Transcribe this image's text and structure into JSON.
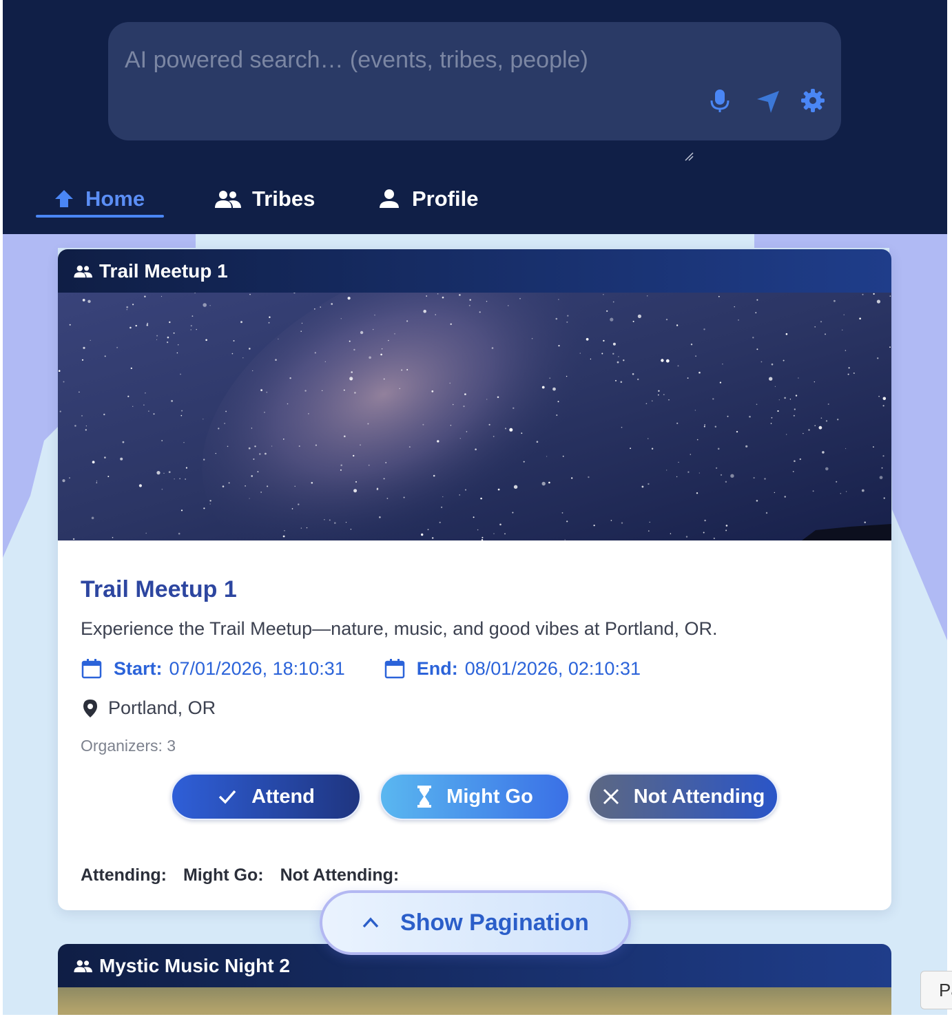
{
  "search": {
    "placeholder": "AI powered search… (events, tribes, people)",
    "icons": [
      "microphone-icon",
      "send-icon",
      "settings-icon"
    ]
  },
  "nav": {
    "items": [
      {
        "label": "Home",
        "icon": "home-icon",
        "active": true
      },
      {
        "label": "Tribes",
        "icon": "group-icon",
        "active": false
      },
      {
        "label": "Profile",
        "icon": "person-icon",
        "active": false
      }
    ]
  },
  "events": [
    {
      "header": "Trail Meetup 1",
      "title": "Trail Meetup 1",
      "description": "Experience the Trail Meetup—nature, music, and good vibes at Portland, OR.",
      "start_label": "Start:",
      "start_value": "07/01/2026, 18:10:31",
      "end_label": "End:",
      "end_value": "08/01/2026, 02:10:31",
      "location": "Portland, OR",
      "organizers": "Organizers: 3",
      "buttons": {
        "attend": "Attend",
        "maybe": "Might Go",
        "not": "Not Attending"
      },
      "counts": {
        "attending": "Attending:",
        "maybe": "Might Go:",
        "not": "Not Attending:"
      }
    },
    {
      "header": "Mystic Music Night 2"
    }
  ],
  "pagination": {
    "label": "Show Pagination"
  },
  "corner_tab": {
    "label": "Pa"
  },
  "colors": {
    "topbar": "#101f47",
    "accent": "#4a86f5",
    "title": "#2d46a0",
    "date": "#2b63d9"
  }
}
